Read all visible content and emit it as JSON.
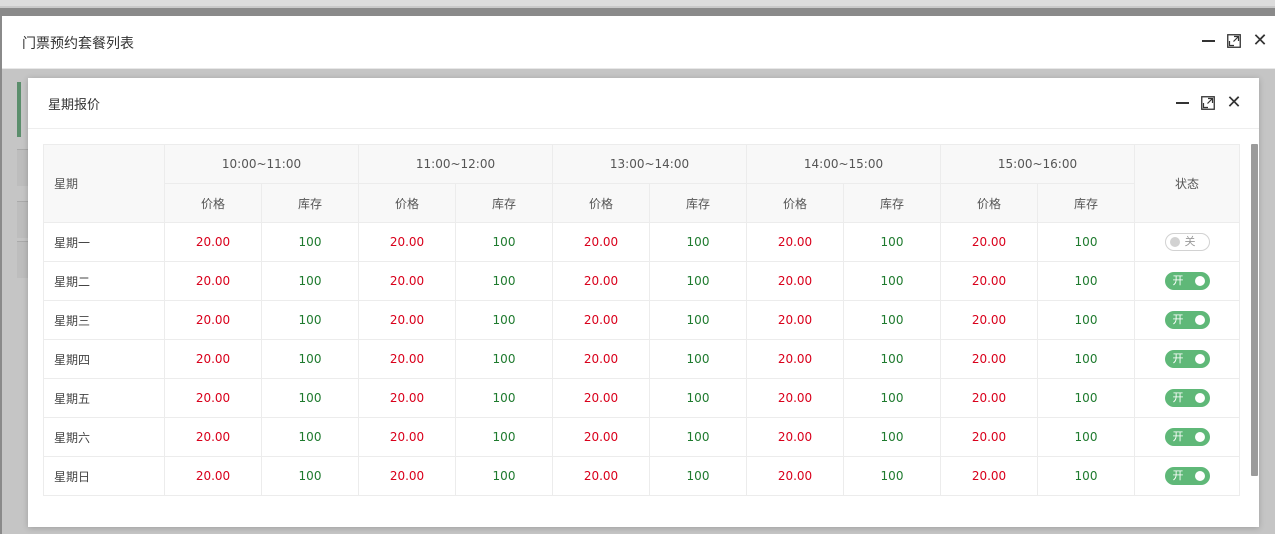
{
  "outer_window": {
    "title": "门票预约套餐列表"
  },
  "inner_window": {
    "title": "星期报价"
  },
  "table": {
    "day_header": "星期",
    "status_header": "状态",
    "price_label": "价格",
    "stock_label": "库存",
    "time_slots": [
      "10:00~11:00",
      "11:00~12:00",
      "13:00~14:00",
      "14:00~15:00",
      "15:00~16:00"
    ],
    "rows": [
      {
        "day": "星期一",
        "cells": [
          [
            "20.00",
            "100"
          ],
          [
            "20.00",
            "100"
          ],
          [
            "20.00",
            "100"
          ],
          [
            "20.00",
            "100"
          ],
          [
            "20.00",
            "100"
          ]
        ],
        "on": false,
        "switch_text": "关"
      },
      {
        "day": "星期二",
        "cells": [
          [
            "20.00",
            "100"
          ],
          [
            "20.00",
            "100"
          ],
          [
            "20.00",
            "100"
          ],
          [
            "20.00",
            "100"
          ],
          [
            "20.00",
            "100"
          ]
        ],
        "on": true,
        "switch_text": "开"
      },
      {
        "day": "星期三",
        "cells": [
          [
            "20.00",
            "100"
          ],
          [
            "20.00",
            "100"
          ],
          [
            "20.00",
            "100"
          ],
          [
            "20.00",
            "100"
          ],
          [
            "20.00",
            "100"
          ]
        ],
        "on": true,
        "switch_text": "开"
      },
      {
        "day": "星期四",
        "cells": [
          [
            "20.00",
            "100"
          ],
          [
            "20.00",
            "100"
          ],
          [
            "20.00",
            "100"
          ],
          [
            "20.00",
            "100"
          ],
          [
            "20.00",
            "100"
          ]
        ],
        "on": true,
        "switch_text": "开"
      },
      {
        "day": "星期五",
        "cells": [
          [
            "20.00",
            "100"
          ],
          [
            "20.00",
            "100"
          ],
          [
            "20.00",
            "100"
          ],
          [
            "20.00",
            "100"
          ],
          [
            "20.00",
            "100"
          ]
        ],
        "on": true,
        "switch_text": "开"
      },
      {
        "day": "星期六",
        "cells": [
          [
            "20.00",
            "100"
          ],
          [
            "20.00",
            "100"
          ],
          [
            "20.00",
            "100"
          ],
          [
            "20.00",
            "100"
          ],
          [
            "20.00",
            "100"
          ]
        ],
        "on": true,
        "switch_text": "开"
      },
      {
        "day": "星期日",
        "cells": [
          [
            "20.00",
            "100"
          ],
          [
            "20.00",
            "100"
          ],
          [
            "20.00",
            "100"
          ],
          [
            "20.00",
            "100"
          ],
          [
            "20.00",
            "100"
          ]
        ],
        "on": true,
        "switch_text": "开"
      }
    ]
  },
  "colors": {
    "price": "#d9001b",
    "stock": "#1e7a2e",
    "switch_on": "#5fb878",
    "switch_off": "#d2d2d2"
  },
  "icons": {
    "minimize": "minimize-icon",
    "maximize": "maximize-icon",
    "close": "close-icon"
  }
}
